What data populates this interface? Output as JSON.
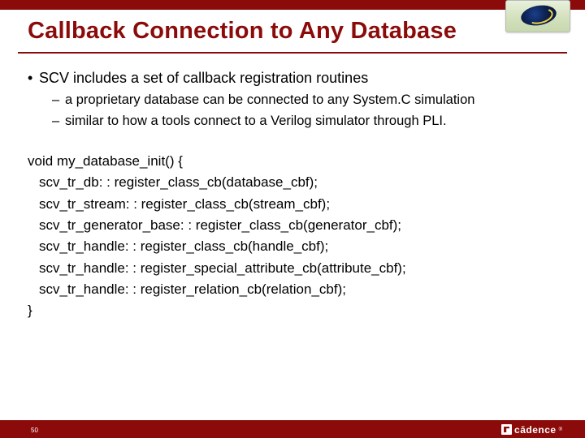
{
  "title": "Callback Connection to Any Database",
  "bullets": {
    "b1": "SCV includes a set of callback registration routines",
    "b1_1": "a proprietary database can be connected to any System.C simulation",
    "b1_2": "similar to how a tools connect to a Verilog simulator through PLI."
  },
  "code": {
    "l0": "void my_database_init() {",
    "l1": "scv_tr_db: : register_class_cb(database_cbf);",
    "l2": "scv_tr_stream: : register_class_cb(stream_cbf);",
    "l3": "scv_tr_generator_base: : register_class_cb(generator_cbf);",
    "l4": "scv_tr_handle: : register_class_cb(handle_cbf);",
    "l5": "scv_tr_handle: : register_special_attribute_cb(attribute_cbf);",
    "l6": "scv_tr_handle: : register_relation_cb(relation_cbf);",
    "l7": "}"
  },
  "footer": {
    "page": "50",
    "brand": "cādence"
  }
}
